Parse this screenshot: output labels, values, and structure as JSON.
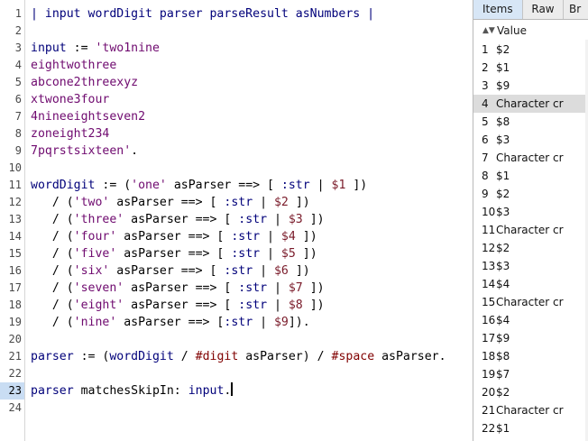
{
  "editor": {
    "current_line": 23,
    "line_numbers": [
      "1",
      "2",
      "3",
      "4",
      "5",
      "6",
      "7",
      "8",
      "9",
      "10",
      "11",
      "12",
      "13",
      "14",
      "15",
      "16",
      "17",
      "18",
      "19",
      "20",
      "21",
      "22",
      "23",
      "24"
    ],
    "lines": [
      [
        {
          "t": "| input wordDigit parser parseResult asNumbers |",
          "c": "kw"
        }
      ],
      [],
      [
        {
          "t": "input",
          "c": "kw"
        },
        {
          "t": " := ",
          "c": ""
        },
        {
          "t": "'two1nine",
          "c": "str"
        }
      ],
      [
        {
          "t": "eightwothree",
          "c": "str"
        }
      ],
      [
        {
          "t": "abcone2threexyz",
          "c": "str"
        }
      ],
      [
        {
          "t": "xtwone3four",
          "c": "str"
        }
      ],
      [
        {
          "t": "4nineeightseven2",
          "c": "str"
        }
      ],
      [
        {
          "t": "zoneight234",
          "c": "str"
        }
      ],
      [
        {
          "t": "7pqrstsixteen'",
          "c": "str"
        },
        {
          "t": ".",
          "c": ""
        }
      ],
      [],
      [
        {
          "t": "wordDigit",
          "c": "kw"
        },
        {
          "t": " := (",
          "c": ""
        },
        {
          "t": "'one'",
          "c": "str"
        },
        {
          "t": " asParser ==> [ ",
          "c": ""
        },
        {
          "t": ":str",
          "c": "kw"
        },
        {
          "t": " | ",
          "c": ""
        },
        {
          "t": "$1",
          "c": "arg"
        },
        {
          "t": " ])",
          "c": ""
        }
      ],
      [
        {
          "t": "   / (",
          "c": ""
        },
        {
          "t": "'two'",
          "c": "str"
        },
        {
          "t": " asParser ==> [ ",
          "c": ""
        },
        {
          "t": ":str",
          "c": "kw"
        },
        {
          "t": " | ",
          "c": ""
        },
        {
          "t": "$2",
          "c": "arg"
        },
        {
          "t": " ])",
          "c": ""
        }
      ],
      [
        {
          "t": "   / (",
          "c": ""
        },
        {
          "t": "'three'",
          "c": "str"
        },
        {
          "t": " asParser ==> [ ",
          "c": ""
        },
        {
          "t": ":str",
          "c": "kw"
        },
        {
          "t": " | ",
          "c": ""
        },
        {
          "t": "$3",
          "c": "arg"
        },
        {
          "t": " ])",
          "c": ""
        }
      ],
      [
        {
          "t": "   / (",
          "c": ""
        },
        {
          "t": "'four'",
          "c": "str"
        },
        {
          "t": " asParser ==> [ ",
          "c": ""
        },
        {
          "t": ":str",
          "c": "kw"
        },
        {
          "t": " | ",
          "c": ""
        },
        {
          "t": "$4",
          "c": "arg"
        },
        {
          "t": " ])",
          "c": ""
        }
      ],
      [
        {
          "t": "   / (",
          "c": ""
        },
        {
          "t": "'five'",
          "c": "str"
        },
        {
          "t": " asParser ==> [ ",
          "c": ""
        },
        {
          "t": ":str",
          "c": "kw"
        },
        {
          "t": " | ",
          "c": ""
        },
        {
          "t": "$5",
          "c": "arg"
        },
        {
          "t": " ])",
          "c": ""
        }
      ],
      [
        {
          "t": "   / (",
          "c": ""
        },
        {
          "t": "'six'",
          "c": "str"
        },
        {
          "t": " asParser ==> [ ",
          "c": ""
        },
        {
          "t": ":str",
          "c": "kw"
        },
        {
          "t": " | ",
          "c": ""
        },
        {
          "t": "$6",
          "c": "arg"
        },
        {
          "t": " ])",
          "c": ""
        }
      ],
      [
        {
          "t": "   / (",
          "c": ""
        },
        {
          "t": "'seven'",
          "c": "str"
        },
        {
          "t": " asParser ==> [ ",
          "c": ""
        },
        {
          "t": ":str",
          "c": "kw"
        },
        {
          "t": " | ",
          "c": ""
        },
        {
          "t": "$7",
          "c": "arg"
        },
        {
          "t": " ])",
          "c": ""
        }
      ],
      [
        {
          "t": "   / (",
          "c": ""
        },
        {
          "t": "'eight'",
          "c": "str"
        },
        {
          "t": " asParser ==> [ ",
          "c": ""
        },
        {
          "t": ":str",
          "c": "kw"
        },
        {
          "t": " | ",
          "c": ""
        },
        {
          "t": "$8",
          "c": "arg"
        },
        {
          "t": " ])",
          "c": ""
        }
      ],
      [
        {
          "t": "   / (",
          "c": ""
        },
        {
          "t": "'nine'",
          "c": "str"
        },
        {
          "t": " asParser ==> [",
          "c": ""
        },
        {
          "t": ":str",
          "c": "kw"
        },
        {
          "t": " | ",
          "c": ""
        },
        {
          "t": "$9",
          "c": "arg"
        },
        {
          "t": "]).",
          "c": ""
        }
      ],
      [],
      [
        {
          "t": "parser",
          "c": "kw"
        },
        {
          "t": " := (",
          "c": ""
        },
        {
          "t": "wordDigit",
          "c": "kw"
        },
        {
          "t": " / ",
          "c": ""
        },
        {
          "t": "#digit",
          "c": "sym"
        },
        {
          "t": " asParser) / ",
          "c": ""
        },
        {
          "t": "#space",
          "c": "sym"
        },
        {
          "t": " asParser.",
          "c": ""
        }
      ],
      [],
      [
        {
          "t": "parser",
          "c": "kw"
        },
        {
          "t": " matchesSkipIn: ",
          "c": ""
        },
        {
          "t": "input",
          "c": "kw"
        },
        {
          "t": ".",
          "c": ""
        }
      ],
      []
    ]
  },
  "inspector": {
    "tabs": [
      "Items",
      "Raw",
      "Br"
    ],
    "active_tab": "Items",
    "column_header": "Value",
    "selected_index": 3,
    "rows": [
      {
        "index": "1",
        "value": "$2"
      },
      {
        "index": "2",
        "value": "$1"
      },
      {
        "index": "3",
        "value": "$9"
      },
      {
        "index": "4",
        "value": "Character cr"
      },
      {
        "index": "5",
        "value": "$8"
      },
      {
        "index": "6",
        "value": "$3"
      },
      {
        "index": "7",
        "value": "Character cr"
      },
      {
        "index": "8",
        "value": "$1"
      },
      {
        "index": "9",
        "value": "$2"
      },
      {
        "index": "10",
        "value": "$3"
      },
      {
        "index": "11",
        "value": "Character cr"
      },
      {
        "index": "12",
        "value": "$2"
      },
      {
        "index": "13",
        "value": "$3"
      },
      {
        "index": "14",
        "value": "$4"
      },
      {
        "index": "15",
        "value": "Character cr"
      },
      {
        "index": "16",
        "value": "$4"
      },
      {
        "index": "17",
        "value": "$9"
      },
      {
        "index": "18",
        "value": "$8"
      },
      {
        "index": "19",
        "value": "$7"
      },
      {
        "index": "20",
        "value": "$2"
      },
      {
        "index": "21",
        "value": "Character cr"
      },
      {
        "index": "22",
        "value": "$1"
      }
    ]
  },
  "colors": {
    "keyword": "#00007a",
    "string": "#6f0a6f",
    "symbol": "#800000",
    "block_arg": "#7a1b2a",
    "selection": "#dcdcdc",
    "active_tab": "#d7e6f6",
    "current_line_gutter": "#c9ddf3"
  }
}
